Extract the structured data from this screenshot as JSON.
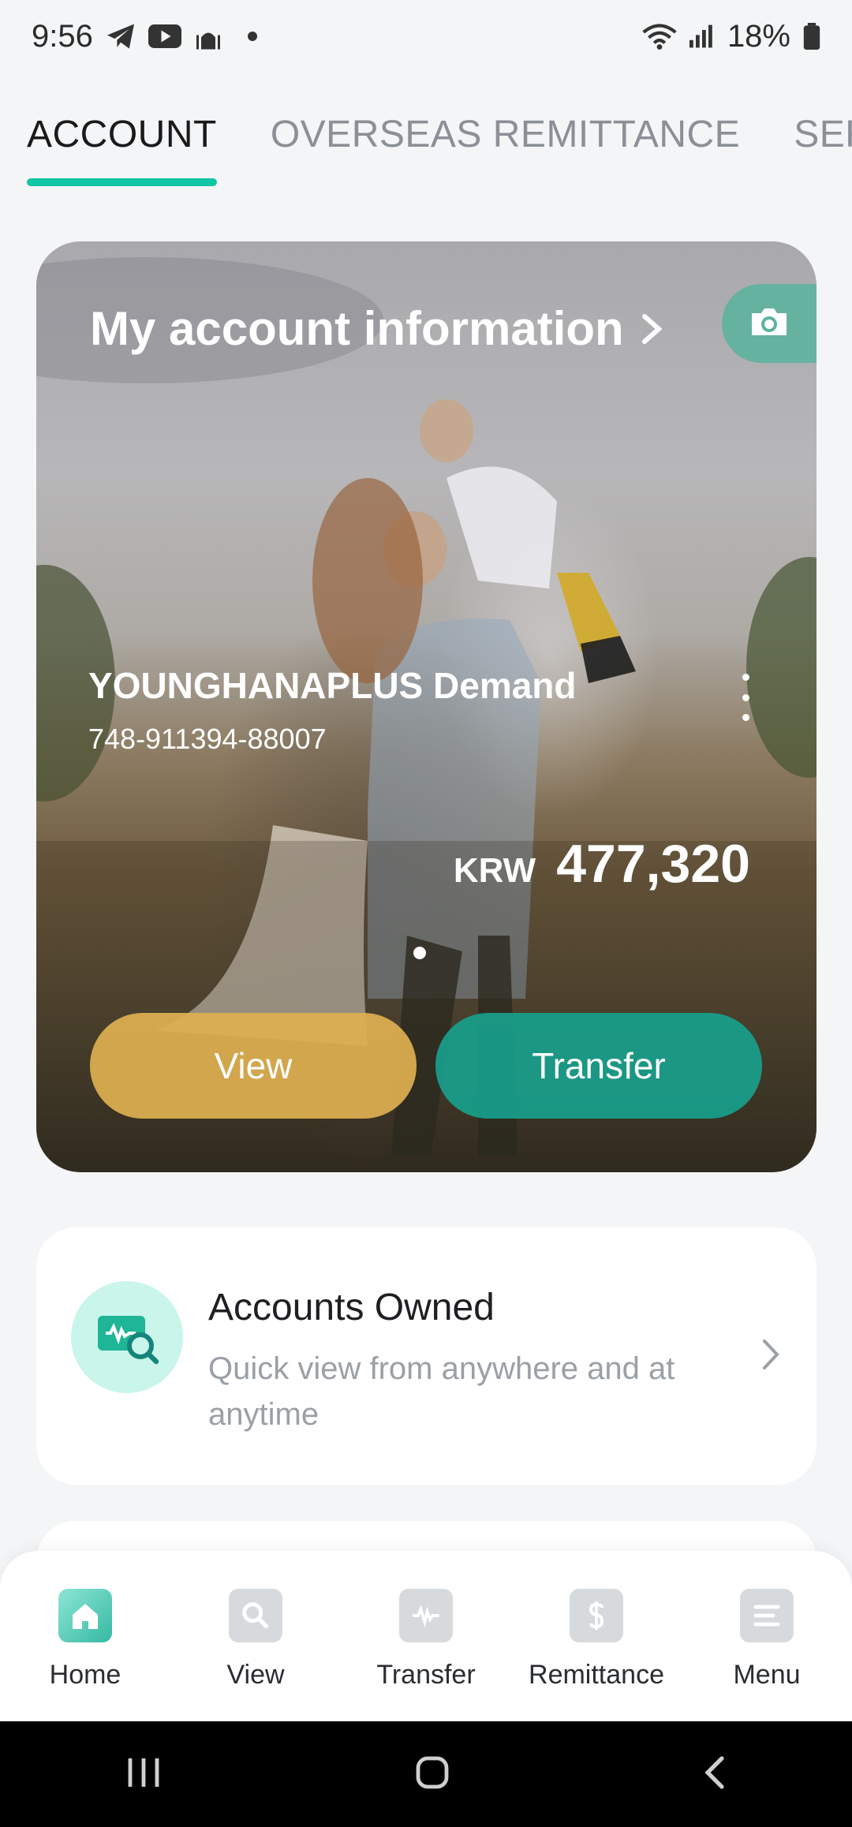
{
  "status_bar": {
    "time": "9:56",
    "battery": "18%",
    "left_icons": [
      "telegram-icon",
      "youtube-icon",
      "mosque-icon",
      "dot"
    ],
    "right_icons": [
      "wifi-icon",
      "signal-icon",
      "battery-icon"
    ]
  },
  "tabs": [
    {
      "label": "ACCOUNT",
      "active": true
    },
    {
      "label": "OVERSEAS REMITTANCE",
      "active": false
    },
    {
      "label": "SERVICE",
      "active": false
    }
  ],
  "hero": {
    "title": "My account information",
    "account_name": "YOUNGHANAPLUS Demand",
    "account_number": "748-911394-88007",
    "currency": "KRW",
    "amount": "477,320",
    "view_label": "View",
    "transfer_label": "Transfer"
  },
  "owned": {
    "title": "Accounts Owned",
    "subtitle": "Quick view from anywhere and at anytime"
  },
  "nav": [
    {
      "label": "Home",
      "icon": "home-icon",
      "active": true
    },
    {
      "label": "View",
      "icon": "search-icon",
      "active": false
    },
    {
      "label": "Transfer",
      "icon": "won-icon",
      "active": false
    },
    {
      "label": "Remittance",
      "icon": "dollar-icon",
      "active": false
    },
    {
      "label": "Menu",
      "icon": "menu-icon",
      "active": false
    }
  ],
  "colors": {
    "accent": "#12c6a4",
    "view_button": "#deb050",
    "transfer_button": "#18a08c"
  }
}
